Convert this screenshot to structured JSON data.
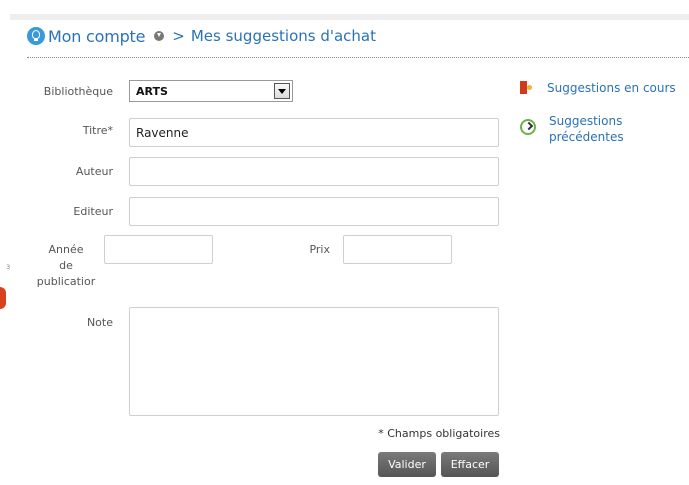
{
  "breadcrumb": {
    "home": "Mon compte",
    "separator": ">",
    "current": "Mes suggestions d'achat"
  },
  "form": {
    "library_label": "Bibliothèque",
    "library_value": "ARTS",
    "title_label": "Titre*",
    "title_value": "Ravenne",
    "author_label": "Auteur",
    "author_value": "",
    "publisher_label": "Editeur",
    "publisher_value": "",
    "year_label_line1": "Année",
    "year_label_line2": "de",
    "year_label_line3": "publicatior",
    "year_value": "",
    "price_label": "Prix",
    "price_value": "",
    "note_label": "Note",
    "note_value": "",
    "required_note": "* Champs obligatoires",
    "submit_label": "Valider",
    "clear_label": "Effacer"
  },
  "side": {
    "current_link": "Suggestions en cours",
    "previous_link_line1": "Suggestions",
    "previous_link_line2": "précédentes"
  },
  "colors": {
    "link": "#2a72b8",
    "button": "#5e5e5e",
    "accent_red": "#d23a1c",
    "accent_green": "#6ab24b"
  },
  "icons": {
    "header": "help-bulb-icon",
    "breadcrumb_dropdown": "chevron-down-circle-icon",
    "current_suggestions": "book-icon",
    "previous_suggestions": "history-clock-icon"
  }
}
